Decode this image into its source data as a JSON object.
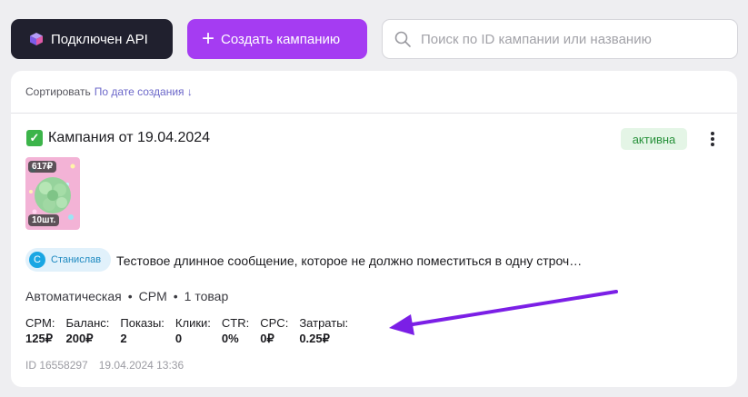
{
  "toolbar": {
    "api_button_label": "Подключен API",
    "create_button_label": "Создать кампанию",
    "search_placeholder": "Поиск по ID кампании или названию",
    "search_value": ""
  },
  "sort": {
    "label": "Сортировать",
    "value": "По дате создания",
    "direction_icon": "↓"
  },
  "campaign": {
    "title": "Кампания от 19.04.2024",
    "status": "активна",
    "status_color": "#27913a",
    "product": {
      "price": "617₽",
      "quantity": "10шт."
    },
    "author": {
      "initial": "С",
      "name": "Станислав"
    },
    "message": "Тестовое длинное сообщение, которое не должно поместиться в одну строч…",
    "meta": {
      "type": "Автоматическая",
      "model": "CPM",
      "items": "1 товар",
      "separator": "•"
    },
    "stats": [
      {
        "label": "CPM:",
        "value": "125₽"
      },
      {
        "label": "Баланс:",
        "value": "200₽"
      },
      {
        "label": "Показы:",
        "value": "2"
      },
      {
        "label": "Клики:",
        "value": "0"
      },
      {
        "label": "CTR:",
        "value": "0%"
      },
      {
        "label": "CPC:",
        "value": "0₽"
      },
      {
        "label": "Затраты:",
        "value": "0.25₽"
      }
    ],
    "id_text": "ID 16558297",
    "created_at": "19.04.2024 13:36"
  },
  "colors": {
    "accent_purple": "#a53cf2",
    "dark_button": "#20202e",
    "annotation_arrow": "#7b1fe6"
  }
}
